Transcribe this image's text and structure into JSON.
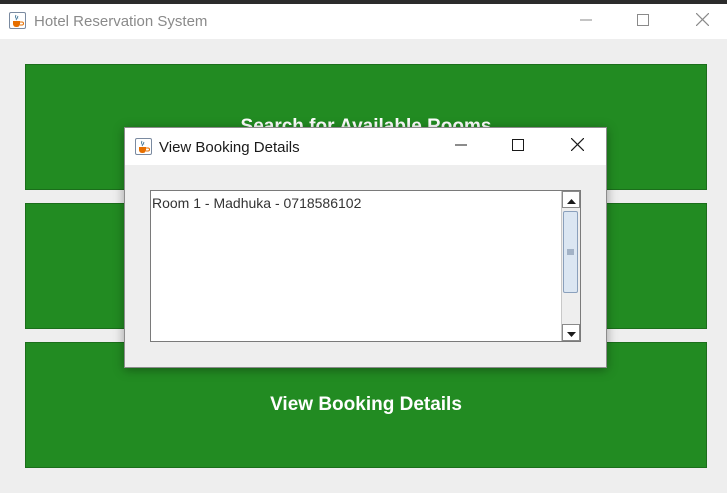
{
  "main_window": {
    "title": "Hotel Reservation System",
    "buttons": [
      {
        "label": "Search for Available Rooms"
      },
      {
        "label": ""
      },
      {
        "label": "View Booking Details"
      }
    ],
    "button_color": "#228b22"
  },
  "dialog": {
    "title": "View Booking Details",
    "text_area": {
      "lines": [
        "Room 1 - Madhuka - 0718586102"
      ]
    }
  },
  "icons": {
    "app": "java-cup-icon",
    "minimize": "minimize-icon",
    "maximize": "maximize-icon",
    "close": "close-icon",
    "scroll_up": "arrow-up-icon",
    "scroll_down": "arrow-down-icon"
  }
}
